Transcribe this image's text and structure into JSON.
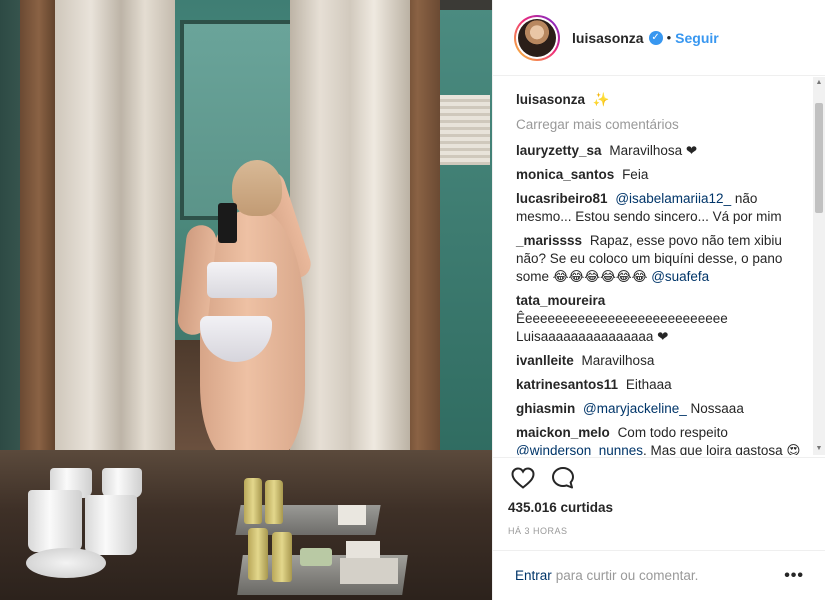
{
  "post": {
    "username": "luisasonza",
    "follow_label": "Seguir",
    "separator": "•",
    "verified_symbol": "✓",
    "caption": "✨",
    "load_more": "Carregar mais comentários",
    "likes": "435.016 curtidas",
    "time_ago": "HÁ 3 HORAS",
    "login_link": "Entrar",
    "login_text": "para curtir ou comentar.",
    "more_options": "•••"
  },
  "comments": [
    {
      "user": "lauryzetty_sa",
      "text": "Maravilhosa ❤"
    },
    {
      "user": "monica_santos",
      "text": "Feia"
    },
    {
      "user": "lucasribeiro81",
      "mention": "@isabelamariia12_",
      "text": "não mesmo... Estou sendo sincero... Vá por mim"
    },
    {
      "user": "_marissss",
      "text": "Rapaz, esse povo não tem xibiu não? Se eu coloco um biquíni desse, o pano some 😂😂😂😂😂😂",
      "mention_after": "@suafefa"
    },
    {
      "user": "tata_moureira",
      "text": "Êeeeeeeeeeeeeeeeeeeeeeeeeeee Luisaaaaaaaaaaaaaaa ❤"
    },
    {
      "user": "ivanlleite",
      "text": "Maravilhosa"
    },
    {
      "user": "katrinesantos11",
      "text": "Eithaaa"
    },
    {
      "user": "ghiasmin",
      "mention": "@maryjackeline_",
      "text": "Nossaaa"
    },
    {
      "user": "maickon_melo",
      "text": "Com todo respeito",
      "mention_after": "@winderson_nunnes",
      "text_after": ". Mas que loira gastosa 😍😍"
    }
  ],
  "icons": {
    "like": "heart-outline-icon",
    "comment": "speech-bubble-icon",
    "verified": "verified-badge-icon",
    "more": "ellipsis-icon"
  },
  "colors": {
    "link": "#3897f0",
    "mention": "#003569",
    "muted": "#999999"
  }
}
